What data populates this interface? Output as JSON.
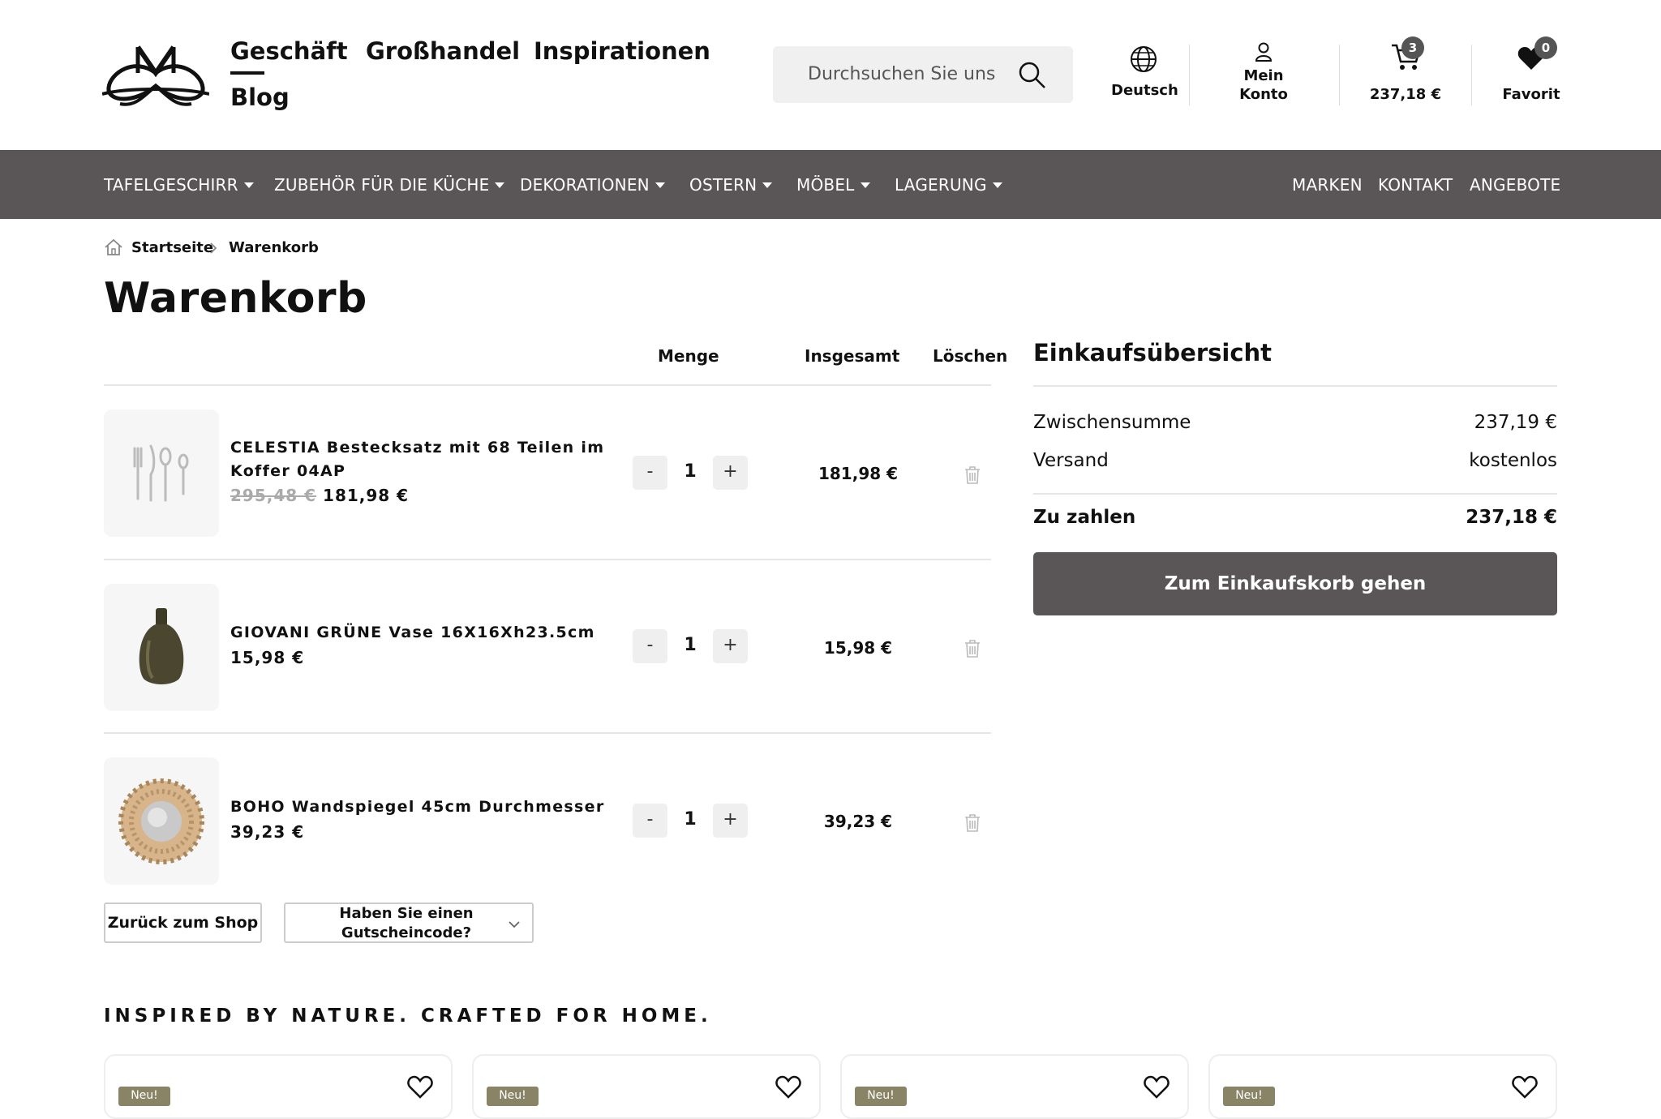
{
  "header": {
    "nav": [
      "Geschäft",
      "Großhandel",
      "Inspirationen",
      "Blog"
    ],
    "search_placeholder": "Durchsuchen Sie uns",
    "language": "Deutsch",
    "account_line1": "Mein",
    "account_line2": "Konto",
    "cart_total": "237,18 €",
    "cart_count": "3",
    "favorites_label": "Favorit",
    "favorites_count": "0"
  },
  "categories": {
    "left": [
      "TAFELGESCHIRR",
      "ZUBEHÖR FÜR DIE KÜCHE",
      "DEKORATIONEN",
      "OSTERN",
      "MÖBEL",
      "LAGERUNG"
    ],
    "right": [
      "MARKEN",
      "KONTAKT",
      "ANGEBOTE"
    ]
  },
  "breadcrumb": {
    "home": "Startseite",
    "current": "Warenkorb"
  },
  "page_title": "Warenkorb",
  "cart": {
    "columns": {
      "quantity": "Menge",
      "total": "Insgesamt",
      "delete": "Löschen"
    },
    "items": [
      {
        "name_line1": "CELESTIA Bestecksatz mit 68 Teilen im",
        "name_line2": "Koffer 04AP",
        "old_price": "295,48 €",
        "price": "181,98 €",
        "qty": "1",
        "total": "181,98 €",
        "image": "cutlery-set"
      },
      {
        "name_line1": "GIOVANI GRÜNE Vase 16X16Xh23.5cm",
        "price": "15,98 €",
        "qty": "1",
        "total": "15,98 €",
        "image": "green-vase"
      },
      {
        "name_line1": "BOHO Wandspiegel 45cm Durchmesser",
        "price": "39,23 €",
        "qty": "1",
        "total": "39,23 €",
        "image": "round-mirror"
      }
    ],
    "minus": "-",
    "plus": "+",
    "back_button": "Zurück zum Shop",
    "coupon_label": "Haben Sie einen Gutscheincode?"
  },
  "summary": {
    "title": "Einkaufsübersicht",
    "subtotal_label": "Zwischensumme",
    "subtotal_value": "237,19 €",
    "shipping_label": "Versand",
    "shipping_value": "kostenlos",
    "pay_label": "Zu zahlen",
    "pay_value": "237,18 €",
    "go_button": "Zum Einkaufskorb gehen"
  },
  "tagline": "INSPIRED BY NATURE. CRAFTED FOR HOME.",
  "product_cards": [
    {
      "badge": "Neu!"
    },
    {
      "badge": "Neu!"
    },
    {
      "badge": "Neu!"
    },
    {
      "badge": "Neu!"
    }
  ],
  "colors": {
    "bar": "#5a5556",
    "badge": "#8a8466"
  }
}
